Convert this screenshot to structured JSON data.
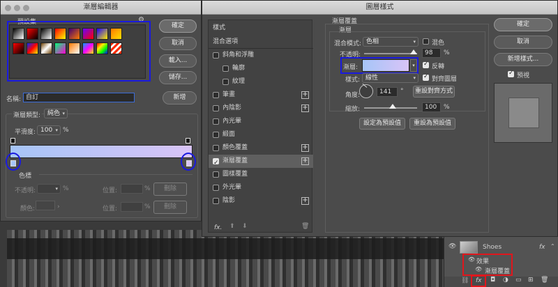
{
  "gradient_editor": {
    "title": "漸層編輯器",
    "presets_label": "預設集",
    "gear": "⚙",
    "buttons": {
      "ok": "確定",
      "cancel": "取消",
      "load": "載入...",
      "save": "儲存...",
      "new": "新增"
    },
    "name_label": "名稱:",
    "name_value": "自訂",
    "type_label": "漸層類型:",
    "type_value": "純色",
    "smoothness_label": "平滑度:",
    "smoothness_value": "100",
    "percent": "%",
    "stops_label": "色標",
    "opacity_label": "不透明:",
    "position_label": "位置:",
    "delete_label": "刪除",
    "color_label": "顏色:",
    "gradient_start": "#a6c5f7",
    "gradient_end": "#d9c4f7",
    "presets": [
      "linear-gradient(135deg,#000,#fff)",
      "linear-gradient(135deg,#ff0000,#000)",
      "linear-gradient(135deg,#000,#fff)",
      "linear-gradient(135deg,#ff0000,#ffff00)",
      "linear-gradient(135deg,#400070,#ff7a00)",
      "linear-gradient(135deg,#6a00ff,#ff0000)",
      "linear-gradient(135deg,#1a00ff,#ffee00)",
      "linear-gradient(135deg,#ff7a00,#ffe100)",
      "linear-gradient(135deg,#ff0000,#000)",
      "linear-gradient(135deg,#002bff,#ff0000,#ffee00)",
      "linear-gradient(135deg,#6b3d00,#fff,#6b3d00)",
      "linear-gradient(135deg,#00ff77,#ff00d4)",
      "linear-gradient(135deg,#ff7a00,#ffffff)",
      "linear-gradient(135deg,#00a2ff,#ff00ff,#ffee00)",
      "linear-gradient(135deg,#ff0000,#ffee00,#00ff00,#0000ff)",
      "repeating-linear-gradient(135deg,#ff2a00 0 3px,#fff 3px 6px)"
    ]
  },
  "layer_style": {
    "title": "圖層樣式",
    "styles_header": "樣式",
    "items": [
      {
        "label": "混合選項",
        "check": false,
        "plus": false,
        "indent": false
      },
      {
        "label": "斜角和浮雕",
        "check": true,
        "on": false,
        "plus": false,
        "indent": false
      },
      {
        "label": "輪廓",
        "check": true,
        "on": false,
        "plus": false,
        "indent": true
      },
      {
        "label": "紋理",
        "check": true,
        "on": false,
        "plus": false,
        "indent": true
      },
      {
        "label": "筆畫",
        "check": true,
        "on": false,
        "plus": true,
        "indent": false
      },
      {
        "label": "內陰影",
        "check": true,
        "on": false,
        "plus": true,
        "indent": false
      },
      {
        "label": "內光暈",
        "check": true,
        "on": false,
        "plus": false,
        "indent": false
      },
      {
        "label": "緞面",
        "check": true,
        "on": false,
        "plus": false,
        "indent": false
      },
      {
        "label": "顏色覆蓋",
        "check": true,
        "on": false,
        "plus": true,
        "indent": false
      },
      {
        "label": "漸層覆蓋",
        "check": true,
        "on": true,
        "plus": true,
        "indent": false,
        "selected": true
      },
      {
        "label": "圖樣覆蓋",
        "check": true,
        "on": false,
        "plus": false,
        "indent": false
      },
      {
        "label": "外光暈",
        "check": true,
        "on": false,
        "plus": false,
        "indent": false
      },
      {
        "label": "陰影",
        "check": true,
        "on": false,
        "plus": true,
        "indent": false
      }
    ],
    "fx_label": "fx.",
    "section_title": "漸層覆蓋",
    "sub_title": "漸層",
    "blend_label": "混合模式:",
    "blend_value": "色相",
    "dither_label": "混色",
    "opacity_label": "不透明:",
    "opacity_value": "98",
    "gradient_label": "漸層:",
    "reverse_label": "反轉",
    "style_label": "樣式:",
    "style_value": "線性",
    "align_label": "對齊圖層",
    "angle_label": "角度:",
    "angle_value": "141",
    "degree": "°",
    "reset_align": "重設對齊方式",
    "scale_label": "縮放:",
    "scale_value": "100",
    "percent": "%",
    "make_default": "設定為預設值",
    "reset_default": "重設為預設值",
    "ok": "確定",
    "cancel": "取消",
    "new_style": "新增樣式...",
    "preview_label": "預視"
  },
  "layers": {
    "layer_name": "Shoes",
    "fx": "fx",
    "effects_label": "效果",
    "effect_item": "漸層覆蓋",
    "footer_fx": "fx"
  }
}
